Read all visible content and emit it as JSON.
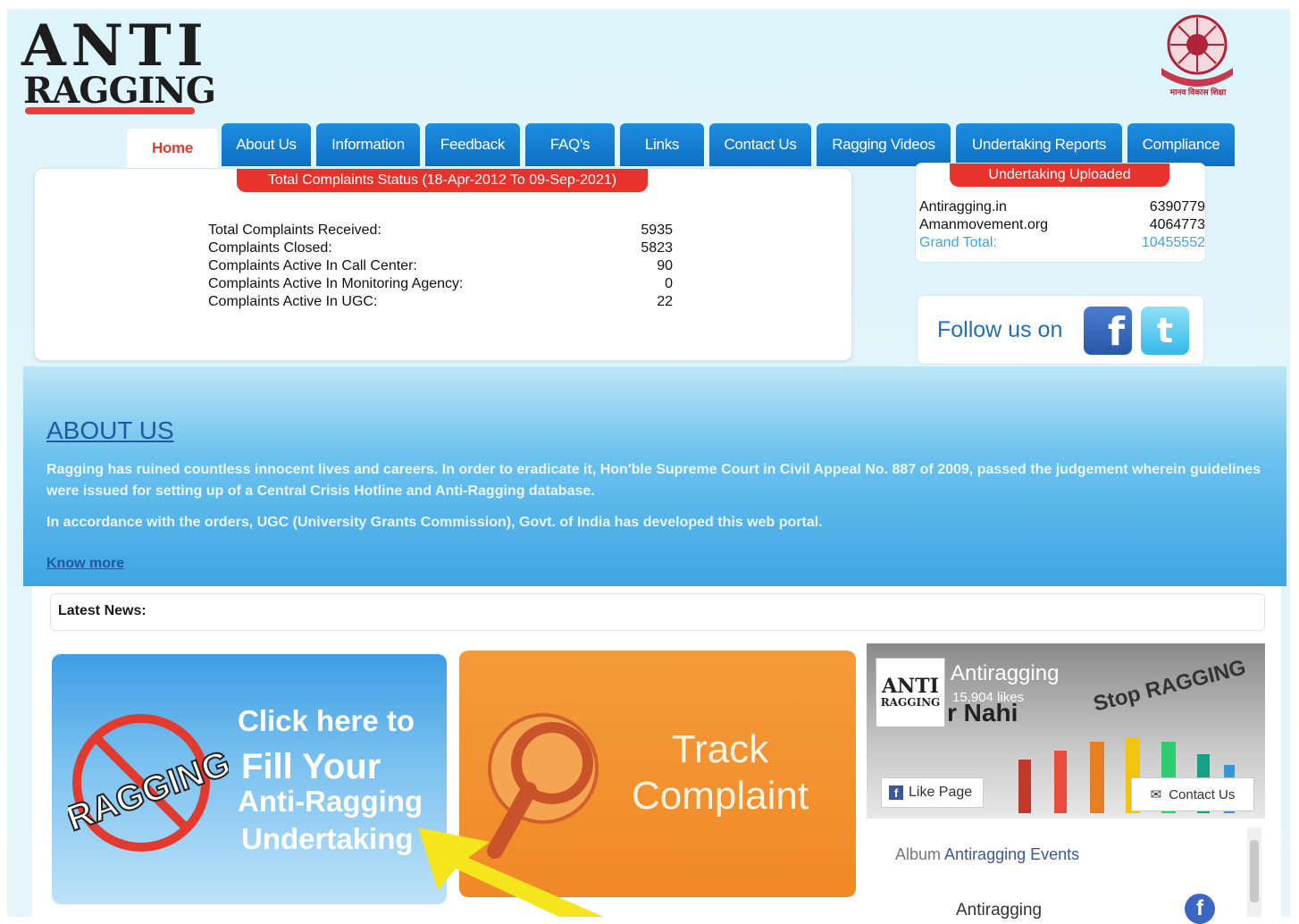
{
  "logo": {
    "line1": "ANTI",
    "line2": "RAGGING"
  },
  "emblem": {
    "caption": "मानव विकास शिक्षा"
  },
  "nav": {
    "tabs": [
      {
        "label": "Home",
        "active": true
      },
      {
        "label": "About Us"
      },
      {
        "label": "Information"
      },
      {
        "label": "Feedback"
      },
      {
        "label": "FAQ's"
      },
      {
        "label": "Links"
      },
      {
        "label": "Contact Us"
      },
      {
        "label": "Ragging Videos"
      },
      {
        "label": "Undertaking Reports"
      },
      {
        "label": "Compliance"
      }
    ]
  },
  "complaints": {
    "heading": "Total Complaints Status (18-Apr-2012 To 09-Sep-2021)",
    "rows": [
      {
        "label": "Total Complaints Received:",
        "value": "5935"
      },
      {
        "label": "Complaints Closed:",
        "value": "5823"
      },
      {
        "label": "Complaints Active In Call Center:",
        "value": "90"
      },
      {
        "label": "Complaints Active In Monitoring Agency:",
        "value": "0"
      },
      {
        "label": "Complaints Active In UGC:",
        "value": "22"
      }
    ]
  },
  "undertaking": {
    "heading": "Undertaking Uploaded",
    "rows": [
      {
        "label": "Antiragging.in",
        "value": "6390779"
      },
      {
        "label": "Amanmovement.org",
        "value": "4064773"
      }
    ],
    "total": {
      "label": "Grand Total:",
      "value": "10455552"
    }
  },
  "follow": {
    "label": "Follow us on",
    "facebook_icon": "facebook-icon",
    "twitter_icon": "twitter-icon"
  },
  "about": {
    "title": "ABOUT US",
    "p1": "Ragging has ruined countless innocent lives and careers. In order to eradicate it, Hon'ble Supreme Court in Civil Appeal No. 887 of 2009, passed the judgement wherein guidelines were issued for setting up of a Central Crisis Hotline and Anti-Ragging database.",
    "p2": "In accordance with the orders, UGC (University Grants Commission), Govt. of India has developed this web portal.",
    "know_more": "Know more"
  },
  "news": {
    "label": "Latest News:"
  },
  "card_undertaking": {
    "line1": "Click here to",
    "line2": "Fill Your",
    "line3": "Anti-Ragging",
    "line4": "Undertaking",
    "sign_text": "RAGGING"
  },
  "card_track": {
    "line1": "Track",
    "line2": "Complaint"
  },
  "fb_widget": {
    "avatar_line1": "ANTI",
    "avatar_line2": "RAGGING",
    "page_name": "Antiragging",
    "likes": "15,904 likes",
    "cover_text1": "r Nahi",
    "cover_text2": "Stop RAGGING",
    "like_button": "Like Page",
    "contact_button": "Contact Us",
    "album_prefix": "Album",
    "album_name": "Antiragging Events",
    "post_title": "Antiragging"
  },
  "colors": {
    "nav_blue": "#1380d4",
    "red": "#e8332d",
    "orange": "#f08a26",
    "link_blue": "#1e5a9e"
  }
}
